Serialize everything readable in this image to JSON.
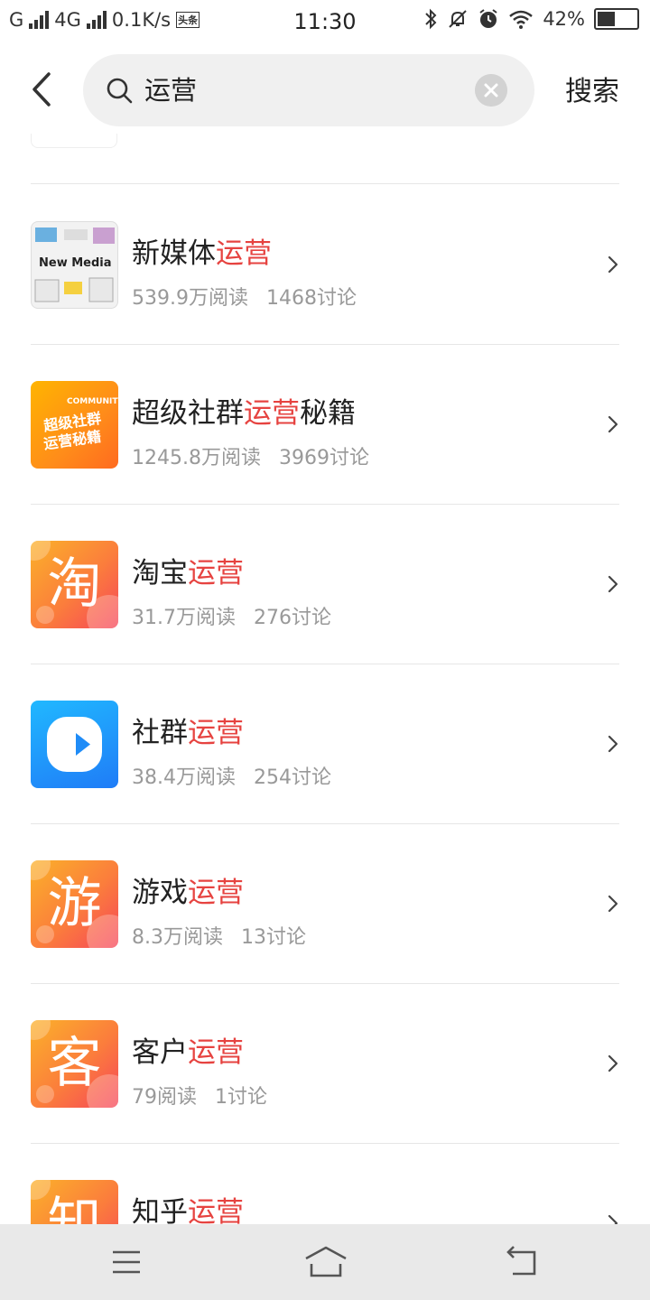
{
  "status_bar": {
    "carrier": "G",
    "network": "4G",
    "speed": "0.1K/s",
    "app_badge": "头条",
    "time": "11:30",
    "battery": "42%"
  },
  "header": {
    "query": "运营",
    "search_label": "搜索"
  },
  "colors": {
    "highlight": "#e64340",
    "meta_text": "#999999"
  },
  "results": [
    {
      "prefix": "新媒体",
      "keyword": "运营",
      "suffix": "",
      "reads": "539.9万阅读",
      "discussions": "1468讨论",
      "icon": "new-media-thumbnail"
    },
    {
      "prefix": "超级社群",
      "keyword": "运营",
      "suffix": "秘籍",
      "reads": "1245.8万阅读",
      "discussions": "3969讨论",
      "icon": "community-thumbnail",
      "thumb_text_top": "COMMUNITY",
      "thumb_text_1": "超级社群",
      "thumb_text_2": "运营秘籍"
    },
    {
      "prefix": "淘宝",
      "keyword": "运营",
      "suffix": "",
      "reads": "31.7万阅读",
      "discussions": "276讨论",
      "icon": "char-thumbnail",
      "char": "淘"
    },
    {
      "prefix": "社群",
      "keyword": "运营",
      "suffix": "",
      "reads": "38.4万阅读",
      "discussions": "254讨论",
      "icon": "play-logo-thumbnail"
    },
    {
      "prefix": "游戏",
      "keyword": "运营",
      "suffix": "",
      "reads": "8.3万阅读",
      "discussions": "13讨论",
      "icon": "char-thumbnail",
      "char": "游"
    },
    {
      "prefix": "客户",
      "keyword": "运营",
      "suffix": "",
      "reads": "79阅读",
      "discussions": "1讨论",
      "icon": "char-thumbnail",
      "char": "客"
    },
    {
      "prefix": "知乎",
      "keyword": "运营",
      "suffix": "",
      "reads": "",
      "discussions": "",
      "icon": "char-thumbnail",
      "char": "知"
    }
  ],
  "new_media_thumb_text": "New Media"
}
